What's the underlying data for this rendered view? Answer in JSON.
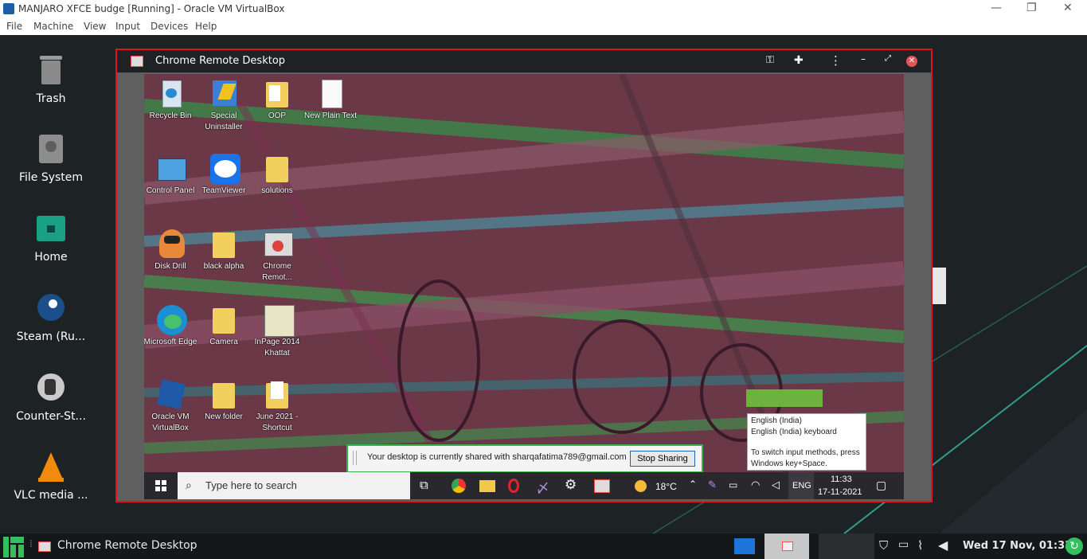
{
  "vbox": {
    "title": "MANJARO XFCE budge [Running] - Oracle VM VirtualBox",
    "menu": [
      "File",
      "Machine",
      "View",
      "Input",
      "Devices",
      "Help"
    ],
    "controls": {
      "minimize": "—",
      "restore": "❐",
      "close": "✕"
    }
  },
  "desktop_icons": [
    {
      "label": "Trash",
      "icon": "trash-icon"
    },
    {
      "label": "File System",
      "icon": "drive-icon"
    },
    {
      "label": "Home",
      "icon": "home-folder-icon"
    },
    {
      "label": "Steam (Ru...",
      "icon": "steam-icon"
    },
    {
      "label": "Counter-St...",
      "icon": "counter-strike-icon"
    },
    {
      "label": "VLC media ...",
      "icon": "vlc-icon"
    }
  ],
  "crd": {
    "title": "Chrome Remote Desktop",
    "icons": [
      "key-icon",
      "extension-icon",
      "more-vert-icon",
      "minimize-icon",
      "maximize-icon",
      "close-icon"
    ]
  },
  "remote_icons": [
    {
      "label": "Recycle Bin",
      "icon": "recycle-bin-icon"
    },
    {
      "label": "Special Uninstaller",
      "icon": "uninstaller-icon"
    },
    {
      "label": "OOP",
      "icon": "folder-icon"
    },
    {
      "label": "New Plain Text",
      "icon": "text-file-icon"
    },
    {
      "label": "Control Panel",
      "icon": "control-panel-icon"
    },
    {
      "label": "TeamViewer",
      "icon": "teamviewer-icon"
    },
    {
      "label": "solutions",
      "icon": "folder-icon"
    },
    {
      "label": "Disk Drill",
      "icon": "disk-drill-icon"
    },
    {
      "label": "black alpha",
      "icon": "folder-icon"
    },
    {
      "label": "Chrome Remot...",
      "icon": "chrome-remote-icon"
    },
    {
      "label": "Microsoft Edge",
      "icon": "edge-icon"
    },
    {
      "label": "Camera",
      "icon": "folder-icon"
    },
    {
      "label": "InPage 2014 Khattat",
      "icon": "inpage-icon"
    },
    {
      "label": "Oracle VM VirtualBox",
      "icon": "virtualbox-icon"
    },
    {
      "label": "New folder",
      "icon": "folder-icon"
    },
    {
      "label": "June 2021 - Shortcut",
      "icon": "folder-icon"
    }
  ],
  "share_bar": {
    "message": "Your desktop is currently shared with sharqafatima789@gmail.com",
    "stop_label": "Stop Sharing"
  },
  "lang_popup": {
    "line1": "English (India)",
    "line2": "English (India) keyboard",
    "hint1": "To switch input methods, press",
    "hint2": "Windows key+Space."
  },
  "win_taskbar": {
    "search_placeholder": "Type here to search",
    "weather": "18°C",
    "lang": "ENG",
    "time": "11:33",
    "date": "17-11-2021"
  },
  "panel": {
    "app_title": "Chrome Remote Desktop",
    "clock": "Wed 17 Nov, 01:33"
  },
  "colors": {
    "crd_border": "#e0131c",
    "share_border": "#38b24a",
    "manjaro_green": "#35bf5c"
  }
}
